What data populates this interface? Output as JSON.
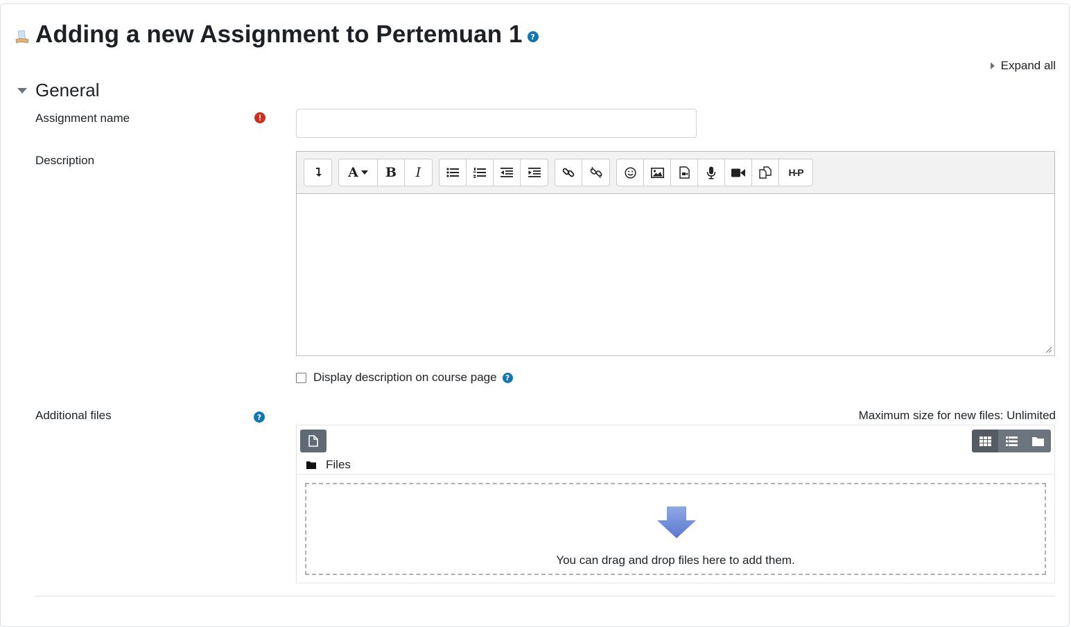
{
  "page": {
    "title": "Adding a new Assignment to Pertemuan 1",
    "expand_all": "Expand all"
  },
  "section": {
    "title": "General"
  },
  "fields": {
    "assignment_name_label": "Assignment name",
    "assignment_name_value": "",
    "description_label": "Description",
    "display_description_label": "Display description on course page",
    "display_description_checked": false,
    "additional_files_label": "Additional files"
  },
  "editor": {
    "toolbar_groups": [
      [
        "show-more-icon"
      ],
      [
        "paragraph-styles-icon",
        "bold-icon",
        "italic-icon"
      ],
      [
        "unordered-list-icon",
        "ordered-list-icon",
        "outdent-icon",
        "indent-icon"
      ],
      [
        "link-icon",
        "unlink-icon"
      ],
      [
        "emoji-icon",
        "image-icon",
        "media-icon",
        "record-audio-icon",
        "record-video-icon",
        "manage-files-icon",
        "h5p-icon"
      ]
    ],
    "bold": "B",
    "italic": "I",
    "para": "A",
    "h5p": "H-P"
  },
  "filepicker": {
    "max_size": "Maximum size for new files: Unlimited",
    "path": "Files",
    "drop_text": "You can drag and drop files here to add them."
  },
  "colors": {
    "help_icon": "#1177b0",
    "required_icon": "#ca3120",
    "drop_arrow": "#6d8bd9"
  }
}
